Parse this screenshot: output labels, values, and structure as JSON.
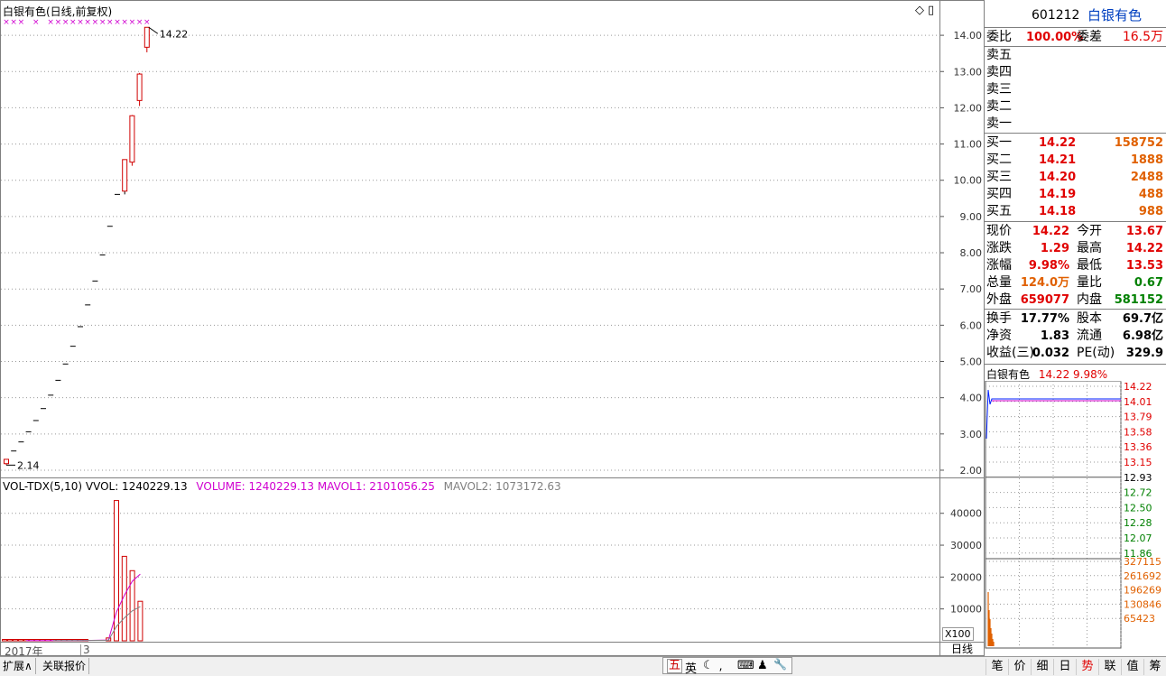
{
  "kline": {
    "title": "白银有色(日线,前复权)",
    "last_label": "14.22",
    "low_label": "2.14",
    "yticks": [
      "14.00",
      "13.00",
      "12.00",
      "11.00",
      "10.00",
      "9.00",
      "8.00",
      "7.00",
      "6.00",
      "5.00",
      "4.00",
      "3.00",
      "2.00"
    ],
    "corner_icons": [
      "◇",
      "▯"
    ]
  },
  "vol": {
    "label": "VOL-TDX(5,10)",
    "vvol": "VVOL: 1240229.13",
    "volume": "VOLUME: 1240229.13",
    "mavol1": "MAVOL1: 2101056.25",
    "mavol2": "MAVOL2: 1073172.63",
    "yticks": [
      "40000",
      "30000",
      "20000",
      "10000"
    ],
    "unit": "X100"
  },
  "timeline": {
    "year": "2017年",
    "month": "3"
  },
  "bottom_tabs": [
    "扩展∧",
    "关联报价"
  ],
  "period": "日线",
  "ime": [
    "五",
    "英",
    "☾",
    "⸴",
    "⌨",
    "♟",
    "🔧"
  ],
  "quote": {
    "code": "601212",
    "name": "白银有色",
    "weibi_label": "委比",
    "weibi": "100.00%",
    "weicha_label": "委差",
    "weicha": "16.5万",
    "sells": [
      "卖五",
      "卖四",
      "卖三",
      "卖二",
      "卖一"
    ],
    "buys": [
      {
        "label": "买一",
        "price": "14.22",
        "vol": "158752"
      },
      {
        "label": "买二",
        "price": "14.21",
        "vol": "1888"
      },
      {
        "label": "买三",
        "price": "14.20",
        "vol": "2488"
      },
      {
        "label": "买四",
        "price": "14.19",
        "vol": "488"
      },
      {
        "label": "买五",
        "price": "14.18",
        "vol": "988"
      }
    ],
    "stats": [
      {
        "l1": "现价",
        "v1": "14.22",
        "c1": "red",
        "l2": "今开",
        "v2": "13.67",
        "c2": "red"
      },
      {
        "l1": "涨跌",
        "v1": "1.29",
        "c1": "red",
        "l2": "最高",
        "v2": "14.22",
        "c2": "red"
      },
      {
        "l1": "涨幅",
        "v1": "9.98%",
        "c1": "red",
        "l2": "最低",
        "v2": "13.53",
        "c2": "red"
      },
      {
        "l1": "总量",
        "v1": "124.0万",
        "c1": "orange",
        "l2": "量比",
        "v2": "0.67",
        "c2": "green"
      },
      {
        "l1": "外盘",
        "v1": "659077",
        "c1": "red",
        "l2": "内盘",
        "v2": "581152",
        "c2": "green"
      }
    ],
    "fin": [
      {
        "l1": "换手",
        "v1": "17.77%",
        "l2": "股本",
        "v2": "69.7亿"
      },
      {
        "l1": "净资",
        "v1": "1.83",
        "l2": "流通",
        "v2": "6.98亿"
      },
      {
        "l1": "收益(三)",
        "v1": "0.032",
        "l2": "PE(动)",
        "v2": "329.9"
      }
    ]
  },
  "minichart": {
    "title": "白银有色",
    "title_price": "14.22 9.98%",
    "prices": [
      "14.22",
      "14.01",
      "13.79",
      "13.58",
      "13.36",
      "13.15",
      "12.93",
      "12.72",
      "12.50",
      "12.28",
      "12.07",
      "11.86"
    ],
    "vols": [
      "327115",
      "261692",
      "196269",
      "130846",
      "65423"
    ]
  },
  "right_tabs": [
    "笔",
    "价",
    "细",
    "日",
    "势",
    "联",
    "值",
    "筹"
  ],
  "chart_data": {
    "type": "candlestick",
    "ylim": [
      1.8,
      14.6
    ],
    "candles": [
      {
        "o": 2.18,
        "h": 2.3,
        "l": 2.14,
        "c": 2.3
      },
      {
        "o": 2.53,
        "h": 2.53,
        "l": 2.53,
        "c": 2.53
      },
      {
        "o": 2.78,
        "h": 2.78,
        "l": 2.78,
        "c": 2.78
      },
      {
        "o": 3.06,
        "h": 3.06,
        "l": 3.06,
        "c": 3.06
      },
      {
        "o": 3.37,
        "h": 3.37,
        "l": 3.37,
        "c": 3.37
      },
      {
        "o": 3.7,
        "h": 3.7,
        "l": 3.7,
        "c": 3.7
      },
      {
        "o": 4.07,
        "h": 4.07,
        "l": 4.07,
        "c": 4.07
      },
      {
        "o": 4.48,
        "h": 4.48,
        "l": 4.48,
        "c": 4.48
      },
      {
        "o": 4.93,
        "h": 4.93,
        "l": 4.93,
        "c": 4.93
      },
      {
        "o": 5.42,
        "h": 5.42,
        "l": 5.42,
        "c": 5.42
      },
      {
        "o": 5.96,
        "h": 5.96,
        "l": 5.96,
        "c": 5.96
      },
      {
        "o": 6.56,
        "h": 6.56,
        "l": 6.56,
        "c": 6.56
      },
      {
        "o": 7.22,
        "h": 7.22,
        "l": 7.22,
        "c": 7.22
      },
      {
        "o": 7.94,
        "h": 7.94,
        "l": 7.94,
        "c": 7.94
      },
      {
        "o": 8.73,
        "h": 8.73,
        "l": 8.73,
        "c": 8.73
      },
      {
        "o": 9.61,
        "h": 9.61,
        "l": 9.61,
        "c": 9.61
      },
      {
        "o": 9.7,
        "h": 10.57,
        "l": 9.61,
        "c": 10.57
      },
      {
        "o": 10.5,
        "h": 11.8,
        "l": 10.4,
        "c": 11.78
      },
      {
        "o": 12.2,
        "h": 12.96,
        "l": 12.05,
        "c": 12.93
      },
      {
        "o": 13.67,
        "h": 14.22,
        "l": 13.53,
        "c": 14.22
      }
    ],
    "volumes": [
      120,
      80,
      60,
      50,
      50,
      60,
      60,
      70,
      70,
      80,
      90,
      80,
      90,
      90,
      100,
      100,
      900,
      44000,
      26500,
      22000,
      12400
    ],
    "mavol1": [
      null,
      null,
      null,
      null,
      80,
      70,
      66,
      68,
      70,
      76,
      80,
      82,
      86,
      88,
      92,
      96,
      250,
      9000,
      14300,
      18700,
      20900
    ],
    "mavol2": [
      null,
      null,
      null,
      null,
      null,
      null,
      null,
      null,
      null,
      80,
      80,
      78,
      80,
      82,
      86,
      90,
      160,
      4500,
      7200,
      9400,
      10700
    ]
  }
}
